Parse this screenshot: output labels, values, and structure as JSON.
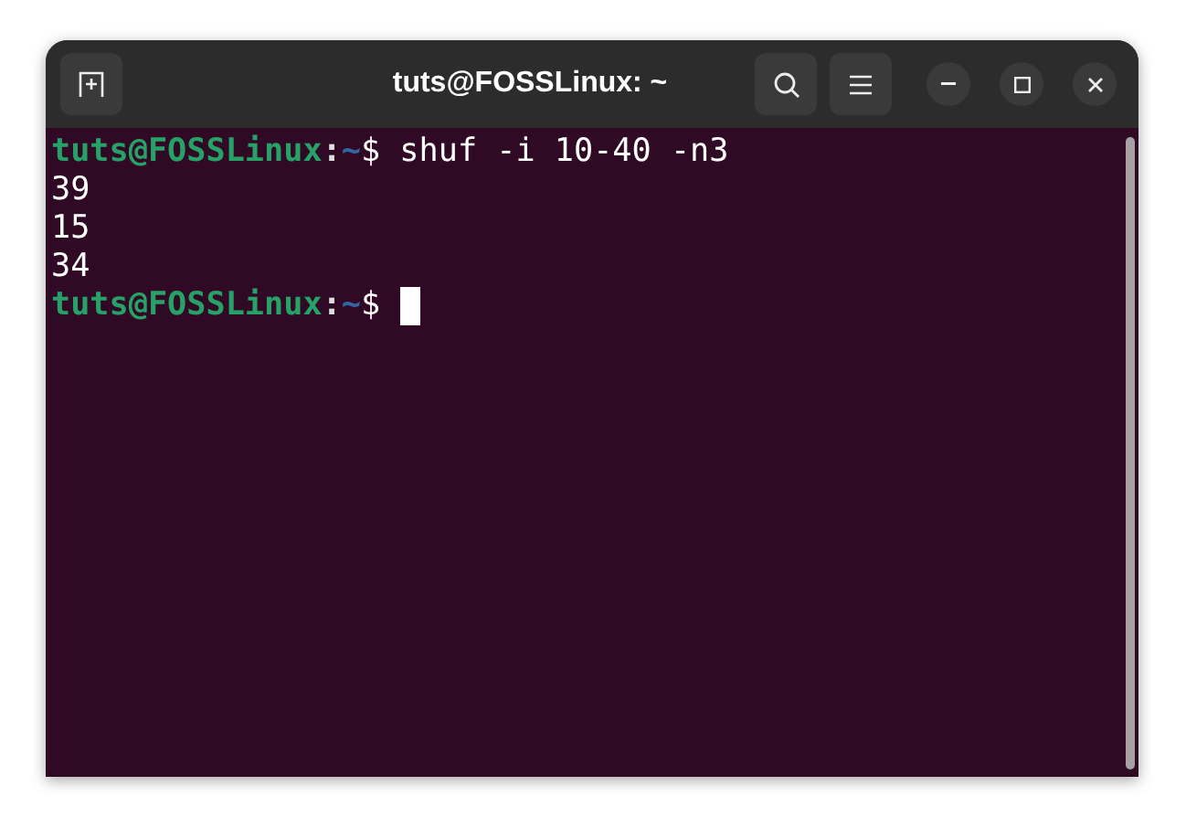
{
  "window": {
    "title": "tuts@FOSSLinux: ~"
  },
  "terminal": {
    "lines": [
      {
        "segments": [
          {
            "kind": "user",
            "text": "tuts@FOSSLinux"
          },
          {
            "kind": "sep",
            "text": ":"
          },
          {
            "kind": "path",
            "text": "~"
          },
          {
            "kind": "plain",
            "text": "$ shuf -i 10-40 -n3"
          }
        ],
        "cursor": false
      },
      {
        "segments": [
          {
            "kind": "plain",
            "text": "39"
          }
        ],
        "cursor": false
      },
      {
        "segments": [
          {
            "kind": "plain",
            "text": "15"
          }
        ],
        "cursor": false
      },
      {
        "segments": [
          {
            "kind": "plain",
            "text": "34"
          }
        ],
        "cursor": false
      },
      {
        "segments": [
          {
            "kind": "user",
            "text": "tuts@FOSSLinux"
          },
          {
            "kind": "sep",
            "text": ":"
          },
          {
            "kind": "path",
            "text": "~"
          },
          {
            "kind": "plain",
            "text": "$ "
          }
        ],
        "cursor": true
      }
    ]
  }
}
